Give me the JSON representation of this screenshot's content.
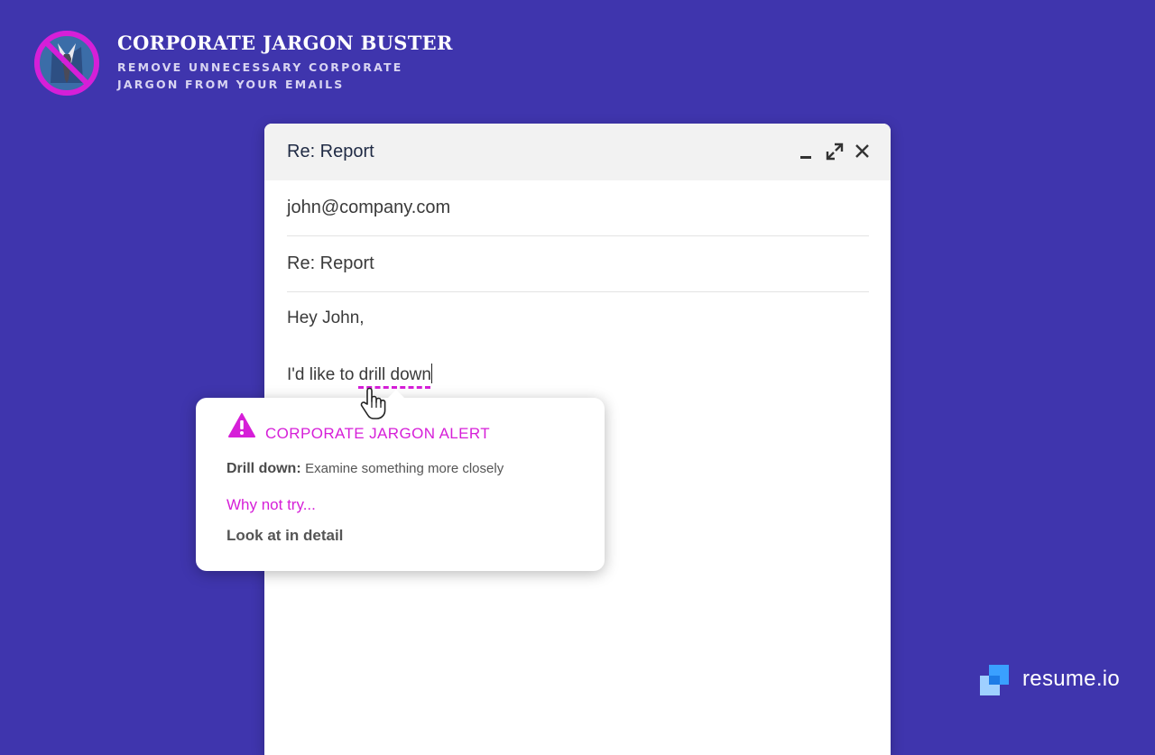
{
  "brand": {
    "title": "CORPORATE JARGON BUSTER",
    "subtitle": "REMOVE UNNECESSARY CORPORATE JARGON FROM YOUR EMAILS",
    "logo_icon": "no-necktie-icon"
  },
  "compose": {
    "window_title": "Re: Report",
    "to": "john@company.com",
    "subject": "Re: Report",
    "greeting": "Hey John,",
    "sentence_prefix": "I'd like to ",
    "jargon_phrase": "drill down",
    "controls": [
      "minimize-icon",
      "expand-icon",
      "close-icon"
    ]
  },
  "popup": {
    "alert_title": "CORPORATE JARGON ALERT",
    "term": "Drill down:",
    "definition": "Examine something more closely",
    "try_label": "Why not try...",
    "suggestion": "Look at in detail"
  },
  "footer": {
    "brand_name": "resume.io"
  },
  "colors": {
    "background": "#3f35ad",
    "accent_magenta": "#d61fd8",
    "window_header": "#f2f2f2"
  }
}
